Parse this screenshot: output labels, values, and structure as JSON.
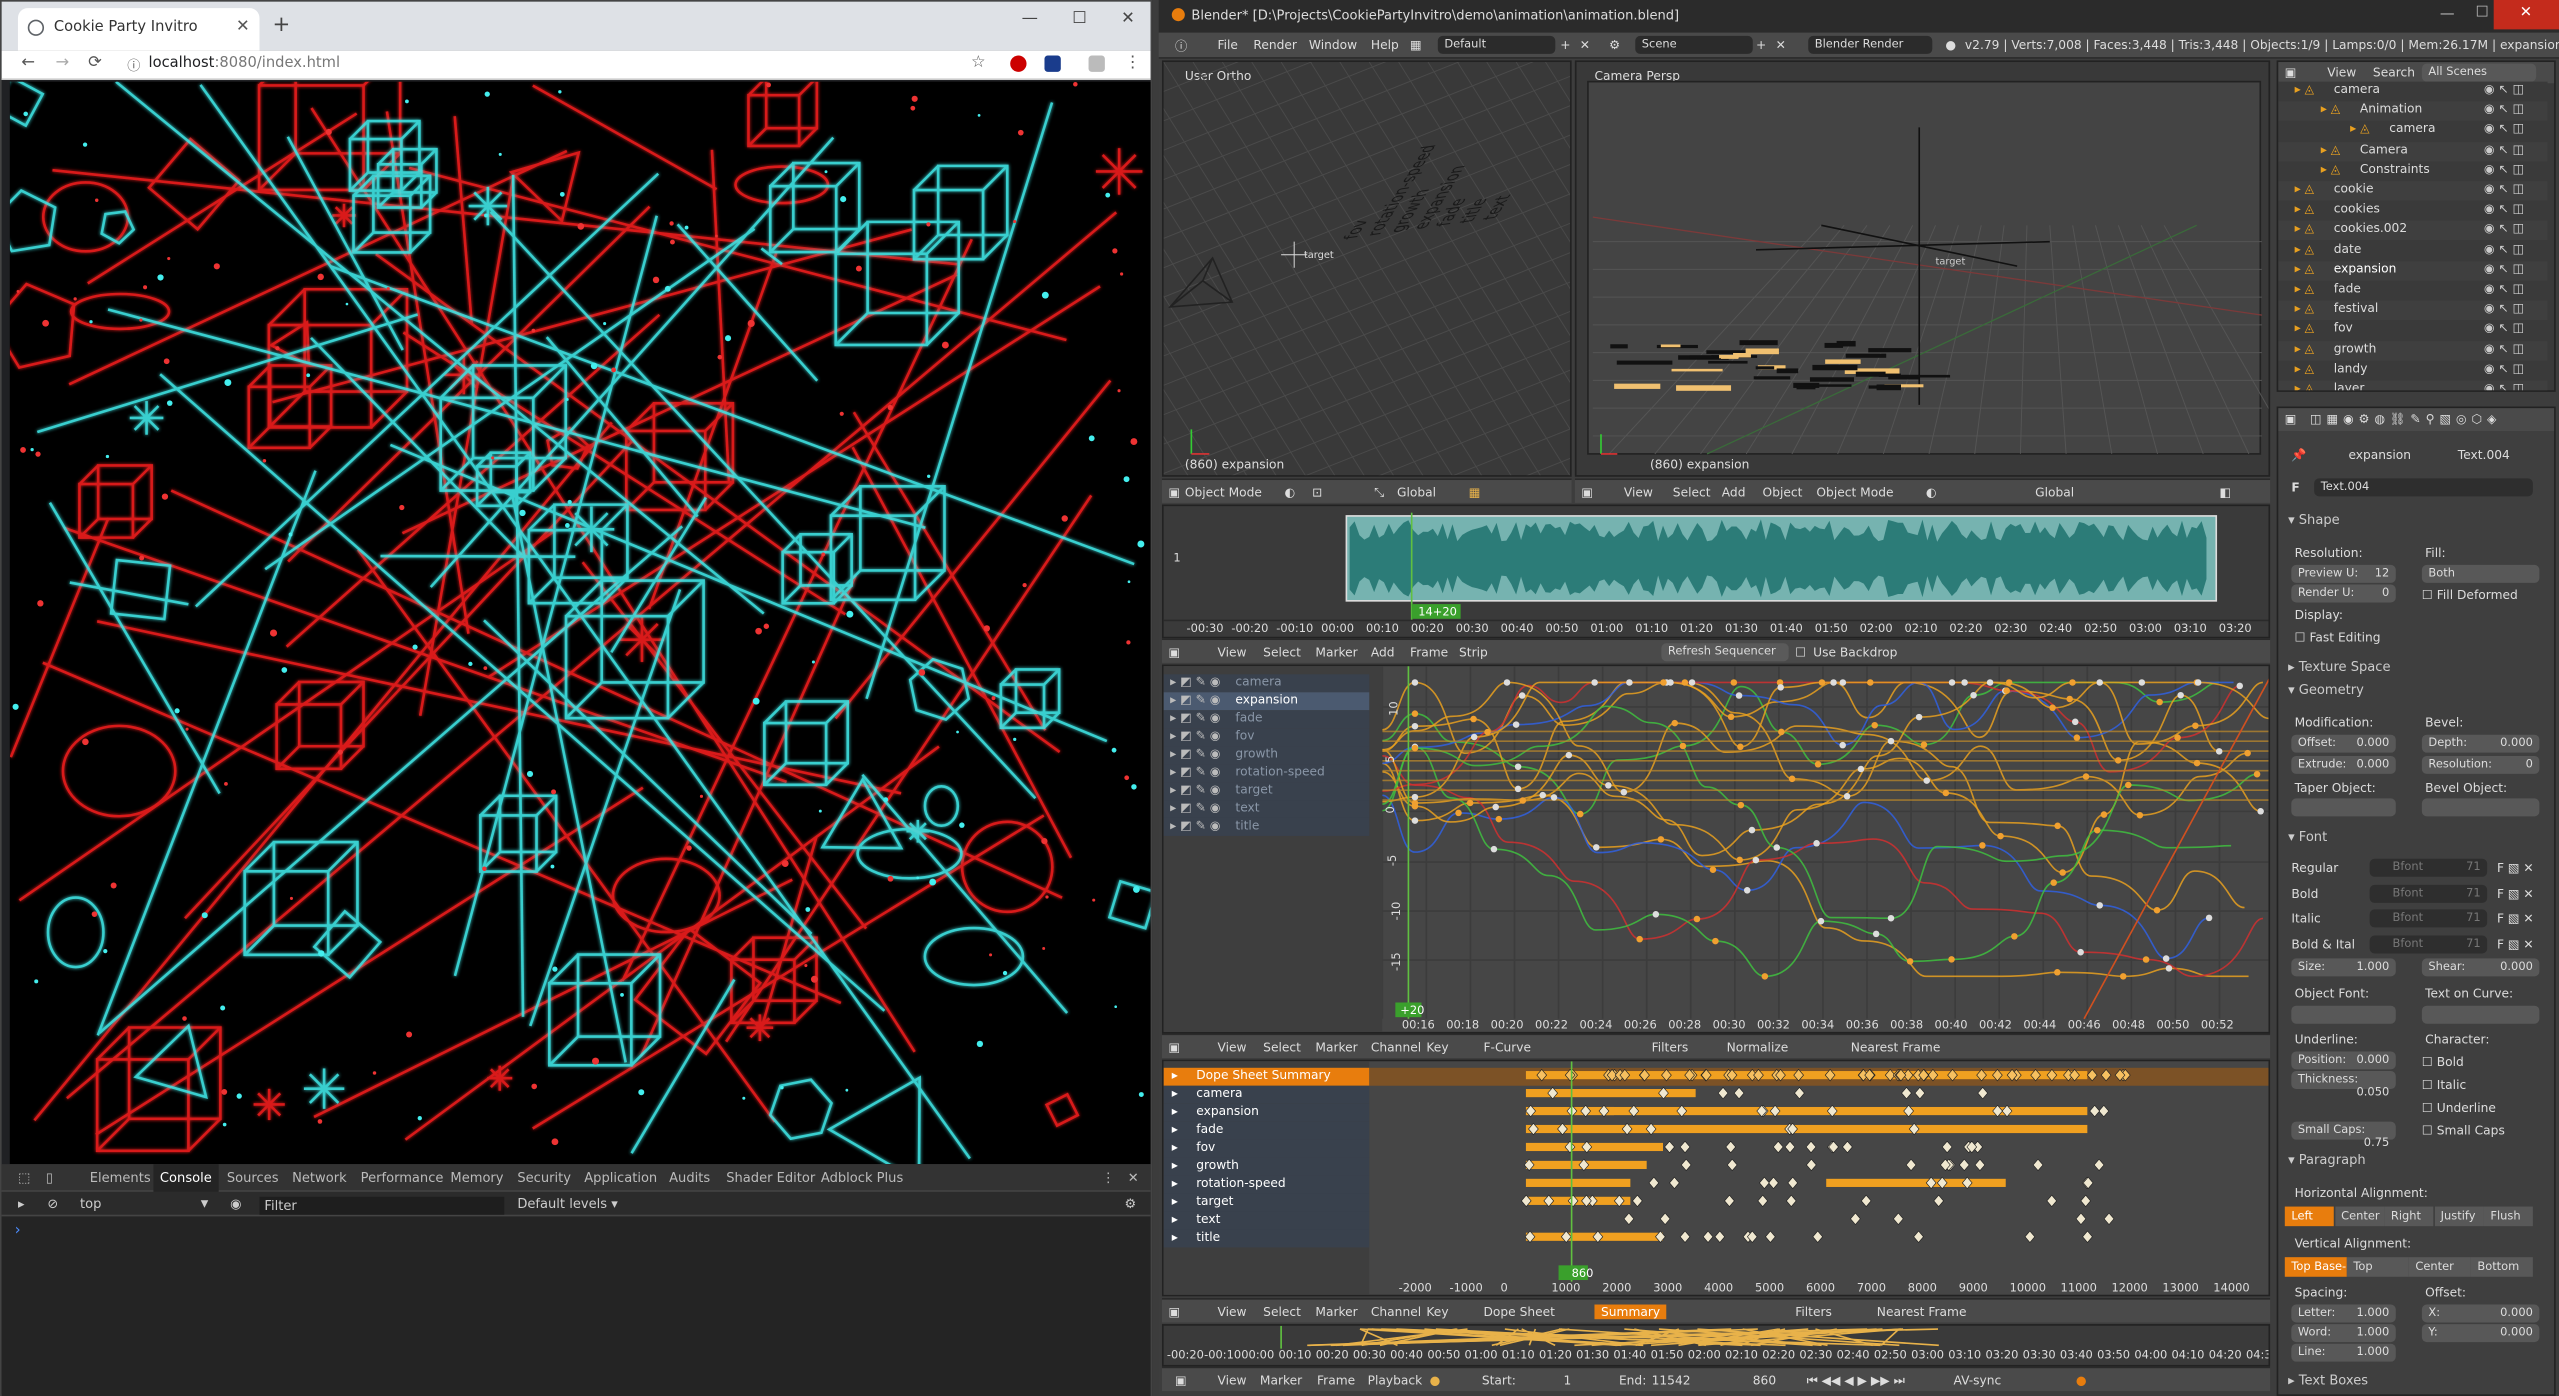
{
  "browser": {
    "tab_title": "Cookie Party Invitro",
    "url_host": "localhost",
    "url_rest": ":8080/index.html",
    "nav_back": "←",
    "nav_forward": "→",
    "nav_reload": "⟳",
    "new_tab": "+",
    "tab_close": "✕",
    "win_min": "—",
    "win_max": "☐",
    "win_close": "✕",
    "devtools": {
      "tabs": [
        "Elements",
        "Console",
        "Sources",
        "Network",
        "Performance",
        "Memory",
        "Security",
        "Application",
        "Audits",
        "Shader Editor",
        "Adblock Plus"
      ],
      "active_tab": "Console",
      "context": "top",
      "filter_placeholder": "Filter",
      "levels": "Default levels ▾",
      "prompt": "›",
      "close": "✕"
    }
  },
  "blender": {
    "title": "Blender* [D:\\Projects\\CookiePartyInvitro\\demo\\animation\\animation.blend]",
    "menus": [
      "File",
      "Render",
      "Window",
      "Help"
    ],
    "layout": "Default",
    "scene": "Scene",
    "engine": "Blender Render",
    "stats": "v2.79 | Verts:7,008 | Faces:3,448 | Tris:3,448 | Objects:1/9 | Lamps:0/0 | Mem:26.17M | expansion",
    "viewport_left": {
      "label": "User Ortho",
      "bottom_label": "(860) expansion",
      "text_objects": [
        "fov",
        "rotation-speed",
        "growth",
        "expansion",
        "fade",
        "title",
        "text",
        "target"
      ],
      "target_label": "target"
    },
    "viewport_right": {
      "label": "Camera Persp",
      "bottom_label": "(860) expansion",
      "target_label": "target"
    },
    "vp_header_left": {
      "mode": "Object Mode",
      "orientation": "Global"
    },
    "vp_header_right": {
      "menus": [
        "View",
        "Select",
        "Add",
        "Object"
      ],
      "mode": "Object Mode",
      "orientation": "Global"
    },
    "sequencer": {
      "channel": "1",
      "frame_badge": "14+20",
      "ticks": [
        "-00:30",
        "-00:20",
        "-00:10",
        "00:00",
        "00:10",
        "00:20",
        "00:30",
        "00:40",
        "00:50",
        "01:00",
        "01:10",
        "01:20",
        "01:30",
        "01:40",
        "01:50",
        "02:00",
        "02:10",
        "02:20",
        "02:30",
        "02:40",
        "02:50",
        "03:00",
        "03:10",
        "03:20"
      ],
      "header": [
        "View",
        "Select",
        "Marker",
        "Add",
        "Frame",
        "Strip"
      ],
      "refresh": "Refresh Sequencer",
      "backdrop": "Use Backdrop"
    },
    "graph": {
      "channels": [
        "camera",
        "expansion",
        "fade",
        "fov",
        "growth",
        "rotation-speed",
        "target",
        "text",
        "title"
      ],
      "active_channel": "expansion",
      "y_ticks": [
        "10",
        "5",
        "0",
        "-5",
        "-10",
        "-15"
      ],
      "x_ticks": [
        "00:16",
        "00:18",
        "00:20",
        "00:22",
        "00:24",
        "00:26",
        "00:28",
        "00:30",
        "00:32",
        "00:34",
        "00:36",
        "00:38",
        "00:40",
        "00:42",
        "00:44",
        "00:46",
        "00:48",
        "00:50",
        "00:52"
      ],
      "frame_badge": "+20",
      "header": [
        "View",
        "Select",
        "Marker",
        "Channel",
        "Key"
      ],
      "mode": "F-Curve",
      "filters": "Filters",
      "normalize": "Normalize",
      "snap": "Nearest Frame"
    },
    "dopesheet": {
      "rows": [
        "Dope Sheet Summary",
        "camera",
        "expansion",
        "fade",
        "fov",
        "growth",
        "rotation-speed",
        "target",
        "text",
        "title"
      ],
      "x_ticks": [
        "-2000",
        "-1000",
        "0",
        "1000",
        "2000",
        "3000",
        "4000",
        "5000",
        "6000",
        "7000",
        "8000",
        "9000",
        "10000",
        "11000",
        "12000",
        "13000",
        "14000"
      ],
      "frame_badge": "860",
      "header": [
        "View",
        "Select",
        "Marker",
        "Channel",
        "Key"
      ],
      "mode": "Dope Sheet",
      "summary": "Summary",
      "filters": "Filters",
      "snap": "Nearest Frame"
    },
    "timeline": {
      "ticks": [
        "-00:20",
        "-00:10",
        "00:00",
        "00:10",
        "00:20",
        "00:30",
        "00:40",
        "00:50",
        "01:00",
        "01:10",
        "01:20",
        "01:30",
        "01:40",
        "01:50",
        "02:00",
        "02:10",
        "02:20",
        "02:30",
        "02:40",
        "02:50",
        "03:00",
        "03:10",
        "03:20",
        "03:30",
        "03:40",
        "03:50",
        "04:00",
        "04:10",
        "04:20",
        "04:30"
      ],
      "menus": [
        "View",
        "Marker",
        "Frame",
        "Playback"
      ],
      "start_label": "Start:",
      "start": "1",
      "end_label": "End:",
      "end": "11542",
      "current": "860",
      "sync": "AV-sync"
    },
    "outliner": {
      "header": [
        "View",
        "Search"
      ],
      "scenes": "All Scenes",
      "rows": [
        "camera",
        "Animation",
        "camera",
        "Camera",
        "Constraints",
        "cookie",
        "cookies",
        "cookies.002",
        "date",
        "expansion",
        "fade",
        "festival",
        "fov",
        "growth",
        "landy",
        "layer"
      ]
    },
    "properties": {
      "breadcrumb_obj": "expansion",
      "breadcrumb_data": "Text.004",
      "datablock": "Text.004",
      "shape": {
        "title": "Shape",
        "resolution": "Resolution:",
        "preview_u": "Preview U:",
        "preview_u_val": "12",
        "render_u": "Render U:",
        "render_u_val": "0",
        "fill": "Fill:",
        "fill_val": "Both",
        "fill_deformed": "Fill Deformed",
        "display": "Display:",
        "fast_editing": "Fast Editing"
      },
      "texture_space": "Texture Space",
      "geometry": {
        "title": "Geometry",
        "modification": "Modification:",
        "offset": "Offset:",
        "offset_val": "0.000",
        "extrude": "Extrude:",
        "extrude_val": "0.000",
        "bevel": "Bevel:",
        "depth": "Depth:",
        "depth_val": "0.000",
        "resolution": "Resolution:",
        "resolution_val": "0",
        "taper": "Taper Object:",
        "bevel_obj": "Bevel Object:"
      },
      "font": {
        "title": "Font",
        "regular": "Regular",
        "bold": "Bold",
        "italic": "Italic",
        "bold_italic": "Bold & Ital",
        "font_name": "Bfont",
        "font_users": "71",
        "size": "Size:",
        "size_val": "1.000",
        "shear": "Shear:",
        "shear_val": "0.000",
        "object_font": "Object Font:",
        "text_on_curve": "Text on Curve:",
        "underline": "Underline:",
        "position": "Position:",
        "position_val": "0.000",
        "thickness": "Thickness:",
        "thickness_val": "0.050",
        "character": "Character:",
        "bold_check": "Bold",
        "italic_check": "Italic",
        "underline_check": "Underline",
        "small_caps": "Small Caps:",
        "small_caps_val": "0.75",
        "small_caps_check": "Small Caps"
      },
      "paragraph": {
        "title": "Paragraph",
        "h_align": "Horizontal Alignment:",
        "h_opts": [
          "Left",
          "Center",
          "Right",
          "Justify",
          "Flush"
        ],
        "v_align": "Vertical Alignment:",
        "v_opts": [
          "Top Base-...",
          "Top",
          "Center",
          "Bottom"
        ],
        "spacing": "Spacing:",
        "letter": "Letter:",
        "letter_val": "1.000",
        "word": "Word:",
        "word_val": "1.000",
        "line": "Line:",
        "line_val": "1.000",
        "offset": "Offset:",
        "x": "X:",
        "x_val": "0.000",
        "y": "Y:",
        "y_val": "0.000"
      },
      "text_boxes": "Text Boxes"
    }
  },
  "colors": {
    "accent": "#e87d0d",
    "cyan": "#3fe0e0",
    "red": "#e02020",
    "blender_bg": "#3d3d3d"
  }
}
